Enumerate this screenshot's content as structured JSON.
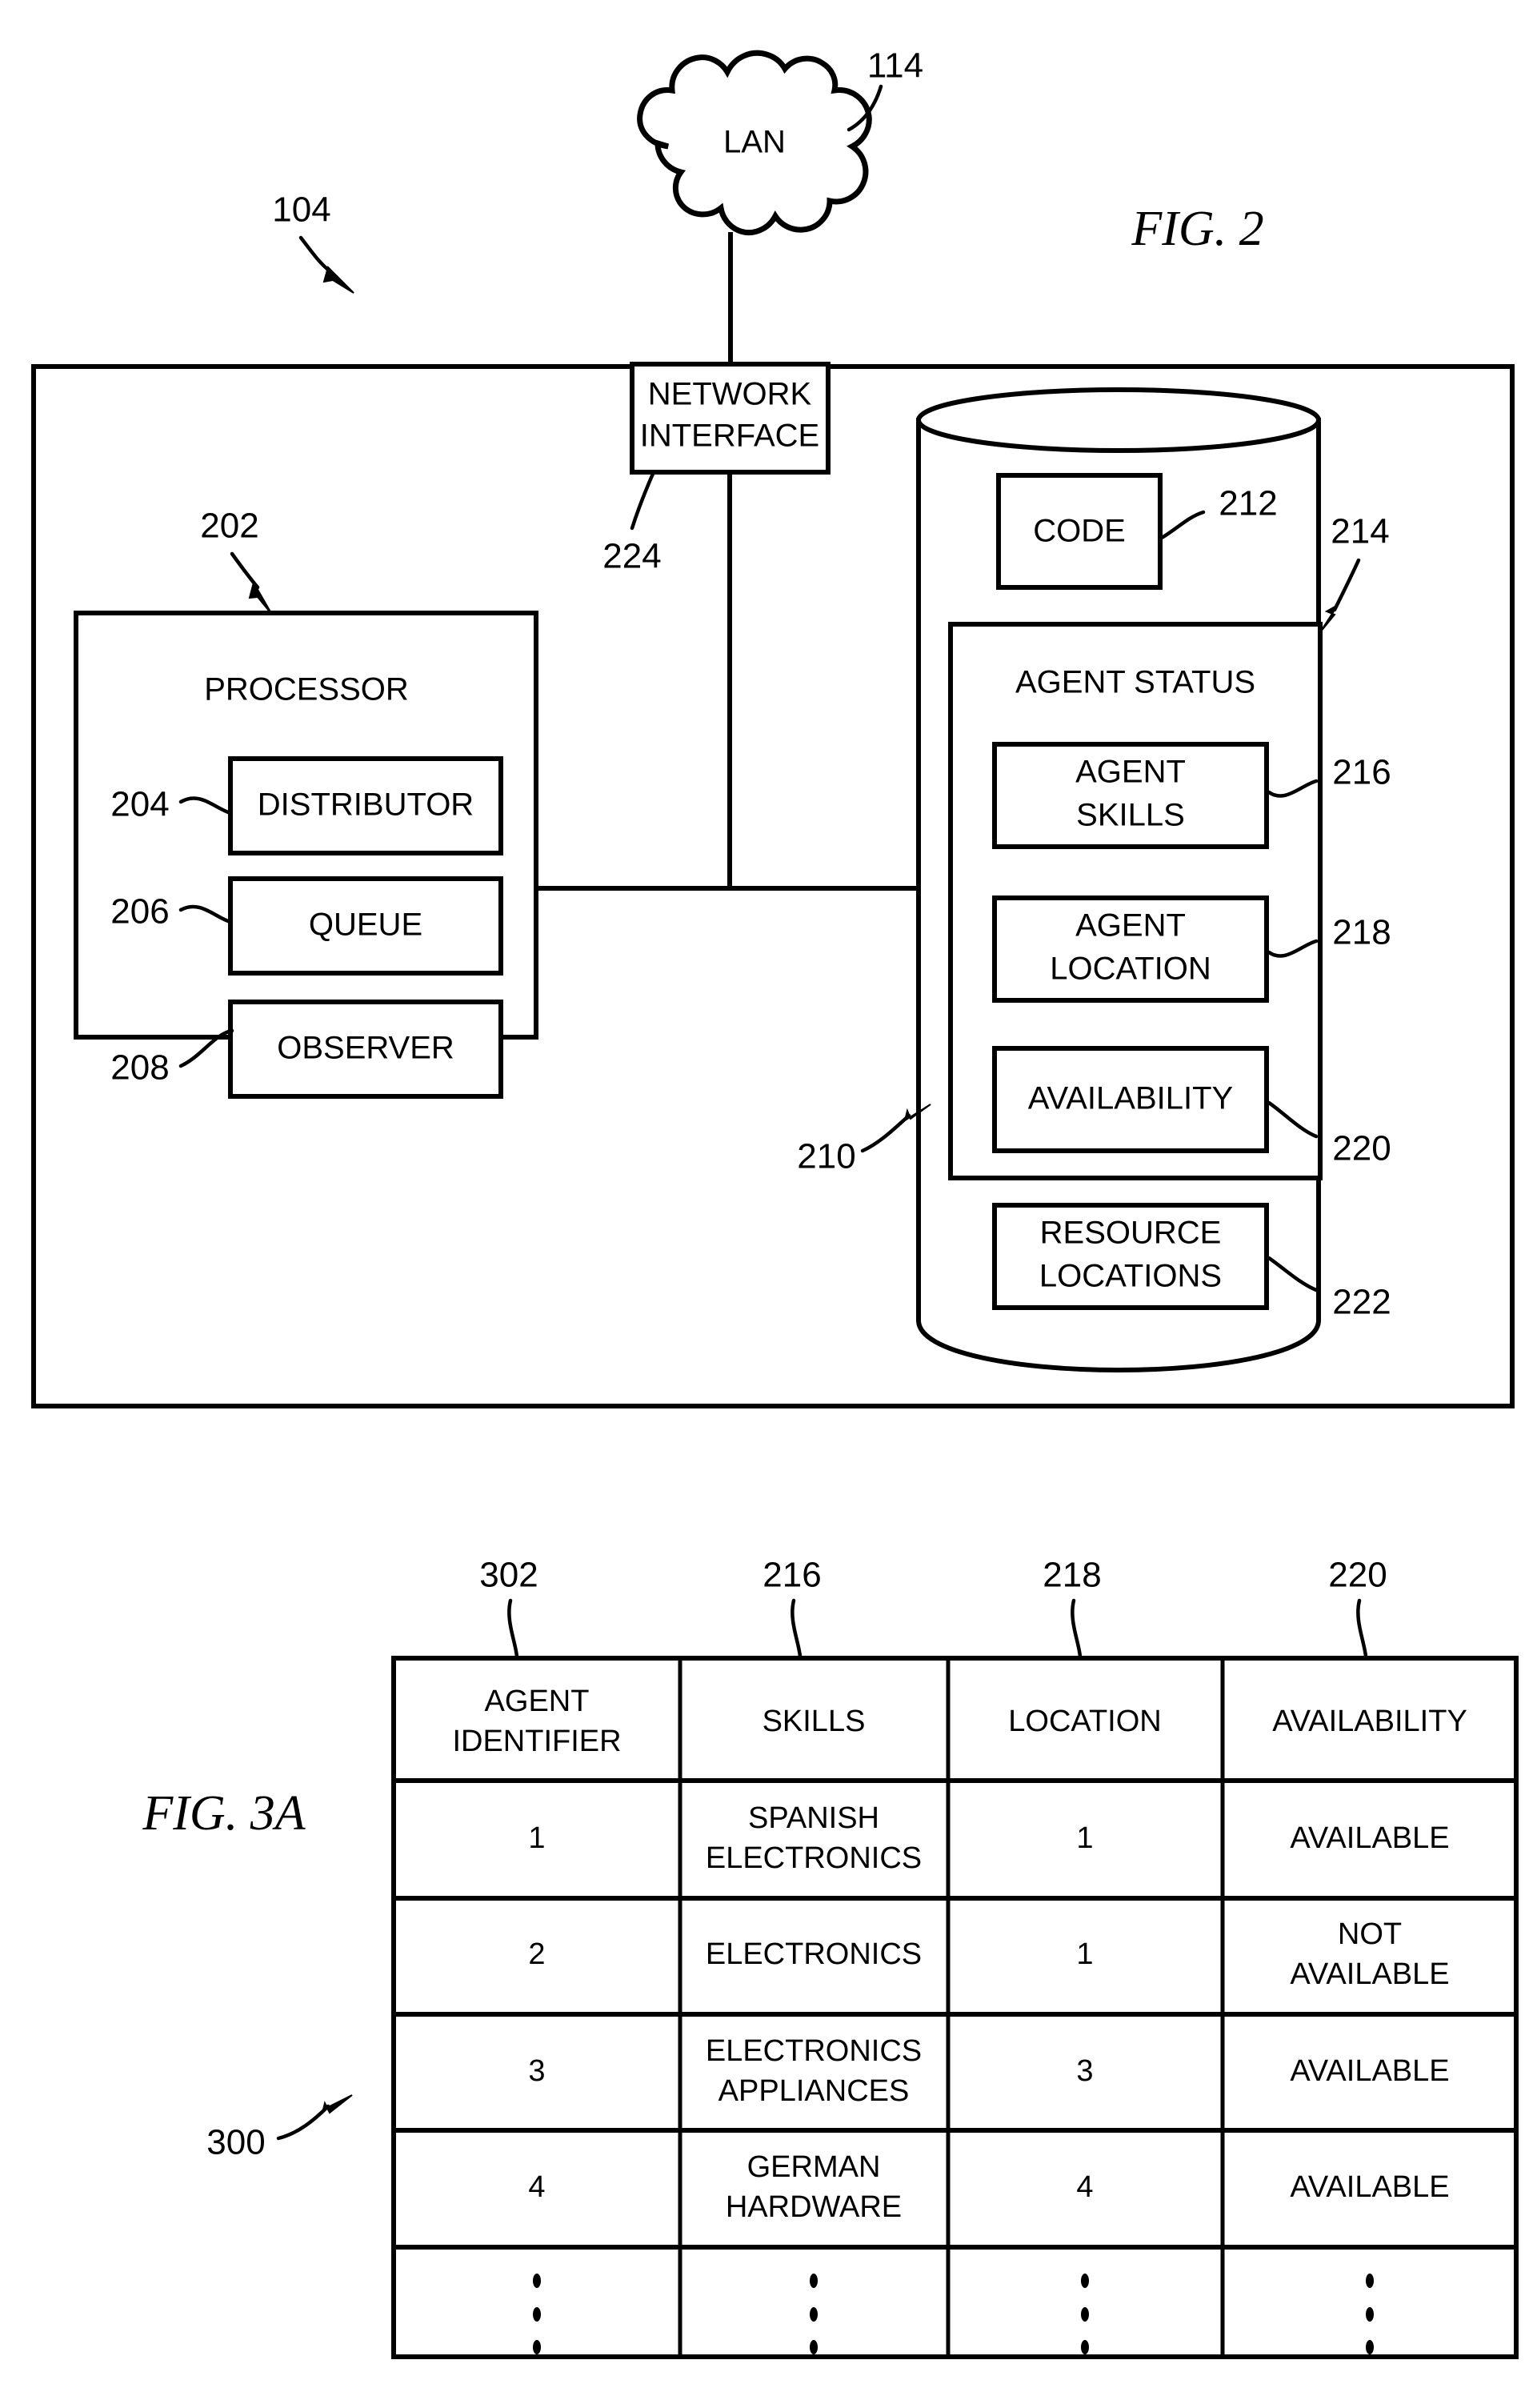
{
  "figures": [
    {
      "id": "fig2",
      "title": "FIG. 2",
      "system_ref": "104",
      "cloud": {
        "label": "LAN",
        "ref": "114"
      },
      "network_interface": {
        "label_line1": "NETWORK",
        "label_line2": "INTERFACE",
        "ref": "224"
      },
      "processor": {
        "label": "PROCESSOR",
        "ref": "202",
        "modules": [
          {
            "label": "DISTRIBUTOR",
            "ref": "204"
          },
          {
            "label": "QUEUE",
            "ref": "206"
          },
          {
            "label": "OBSERVER",
            "ref": "208"
          }
        ]
      },
      "database": {
        "ref": "210",
        "code": {
          "label": "CODE",
          "ref": "212"
        },
        "agent_status": {
          "label": "AGENT STATUS",
          "ref": "214",
          "fields": [
            {
              "label_line1": "AGENT",
              "label_line2": "SKILLS",
              "ref": "216"
            },
            {
              "label_line1": "AGENT",
              "label_line2": "LOCATION",
              "ref": "218"
            },
            {
              "label_line1": "AVAILABILITY",
              "label_line2": "",
              "ref": "220"
            }
          ]
        },
        "resource_locations": {
          "label_line1": "RESOURCE",
          "label_line2": "LOCATIONS",
          "ref": "222"
        }
      }
    },
    {
      "id": "fig3a",
      "title": "FIG. 3A",
      "table_ref": "300",
      "column_refs": [
        "302",
        "216",
        "218",
        "220"
      ],
      "columns": [
        {
          "header_line1": "AGENT",
          "header_line2": "IDENTIFIER"
        },
        {
          "header_line1": "SKILLS",
          "header_line2": ""
        },
        {
          "header_line1": "LOCATION",
          "header_line2": ""
        },
        {
          "header_line1": "AVAILABILITY",
          "header_line2": ""
        }
      ],
      "rows": [
        {
          "agent_identifier": "1",
          "skills_line1": "SPANISH",
          "skills_line2": "ELECTRONICS",
          "location": "1",
          "availability_line1": "AVAILABLE",
          "availability_line2": ""
        },
        {
          "agent_identifier": "2",
          "skills_line1": "ELECTRONICS",
          "skills_line2": "",
          "location": "1",
          "availability_line1": "NOT",
          "availability_line2": "AVAILABLE"
        },
        {
          "agent_identifier": "3",
          "skills_line1": "ELECTRONICS",
          "skills_line2": "APPLIANCES",
          "location": "3",
          "availability_line1": "AVAILABLE",
          "availability_line2": ""
        },
        {
          "agent_identifier": "4",
          "skills_line1": "GERMAN",
          "skills_line2": "HARDWARE",
          "location": "4",
          "availability_line1": "AVAILABLE",
          "availability_line2": ""
        },
        {
          "agent_identifier": "⋮",
          "skills_line1": "⋮",
          "skills_line2": "",
          "location": "⋮",
          "availability_line1": "⋮",
          "availability_line2": ""
        }
      ]
    }
  ],
  "colors": {
    "ink": "#000000",
    "paper": "#ffffff"
  }
}
